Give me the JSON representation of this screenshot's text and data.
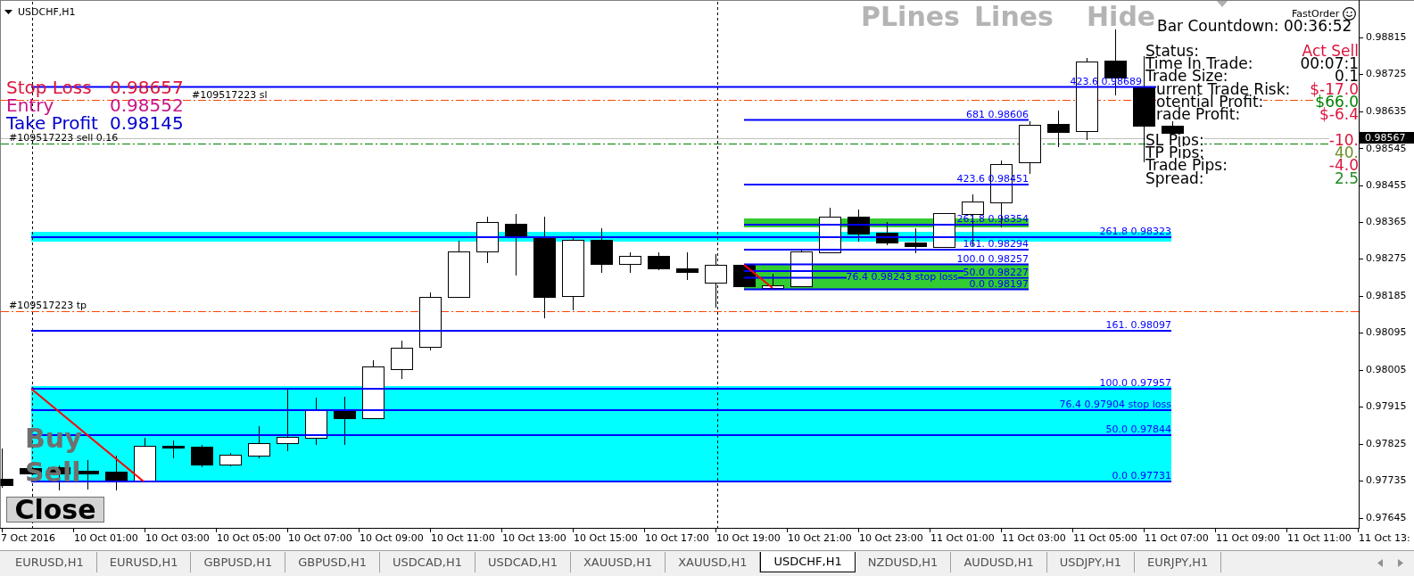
{
  "window": {
    "title": "USDCHF,H1"
  },
  "overlay_buttons": [
    "PLines",
    "Lines",
    "Hide"
  ],
  "trade_summary": [
    {
      "label": "Stop Loss",
      "value": "0.98657",
      "color": "#dc143c"
    },
    {
      "label": "Entry",
      "value": "0.98552",
      "color": "#c71585"
    },
    {
      "label": "Take Profit",
      "value": "0.98145",
      "color": "#0000cd"
    }
  ],
  "order_lines": [
    {
      "kind": "sl",
      "label": "#109517223 sl"
    },
    {
      "kind": "open",
      "label": "#109517223 sell 0.16"
    },
    {
      "kind": "tp",
      "label": "#109517223 tp"
    }
  ],
  "fibonacci": [
    {
      "levels": [
        "423.6 0.98689",
        "261.8 0.98323",
        "161. 0.98097",
        "100.0 0.97957",
        "76.4 0.97904 stop loss",
        "50.0 0.97844",
        "0.0 0.97731"
      ]
    },
    {
      "levels": [
        "681 0.98606",
        "423.6 0.98451",
        "261.8 0.98354",
        "161. 0.98294",
        "100.0 0.98257",
        "76.4 0.98243 stop loss",
        "50.0 0.98227",
        "0.0 0.98197"
      ]
    }
  ],
  "info_panel": {
    "brand": "FastOrder",
    "countdown": "Bar Countdown: 00:36:52",
    "sections": [
      {
        "rows": [
          {
            "label": "Status:",
            "value": "Act Sell",
            "color": "#dc143c"
          },
          {
            "label": "Time In Trade:",
            "value": "00:07:1",
            "color": "#000000"
          },
          {
            "label": "Trade Size:",
            "value": "0.1",
            "color": "#000000"
          },
          {
            "label": "urrent Trade Risk:",
            "value": "$-17.0",
            "color": "#dc143c"
          },
          {
            "label": "otential Profit:",
            "value": "$66.0",
            "color": "#008000"
          },
          {
            "label": "rade Profit:",
            "value": "$-6.4",
            "color": "#dc143c"
          }
        ]
      },
      {
        "rows": [
          {
            "label": "SL Pips:",
            "value": "-10.",
            "color": "#dc143c"
          },
          {
            "label": "TP Pips:",
            "value": "40.",
            "color": "#6b8e23"
          },
          {
            "label": "Trade Pips:",
            "value": "-4.0",
            "color": "#dc143c"
          },
          {
            "label": "Spread:",
            "value": "2.5",
            "color": "#228b22"
          }
        ]
      }
    ]
  },
  "order_buttons": [
    "Buy",
    "Sell"
  ],
  "close_button": "Close",
  "price_axis": {
    "ticks": [
      "0.98815",
      "0.98725",
      "0.98635",
      "0.98545",
      "0.98455",
      "0.98365",
      "0.98275",
      "0.98185",
      "0.98095",
      "0.98005",
      "0.97915",
      "0.97825",
      "0.97735",
      "0.97645"
    ],
    "current": "0.98567"
  },
  "time_axis": [
    "7 Oct 2016",
    "10 Oct 01:00",
    "10 Oct 03:00",
    "10 Oct 05:00",
    "10 Oct 07:00",
    "10 Oct 09:00",
    "10 Oct 11:00",
    "10 Oct 13:00",
    "10 Oct 15:00",
    "10 Oct 17:00",
    "10 Oct 19:00",
    "10 Oct 21:00",
    "10 Oct 23:00",
    "11 Oct 01:00",
    "11 Oct 03:00",
    "11 Oct 05:00",
    "11 Oct 07:00",
    "11 Oct 09:00",
    "11 Oct 11:00",
    "11 Oct 13:"
  ],
  "tabs": [
    {
      "label": "EURUSD,H1",
      "selected": false
    },
    {
      "label": "EURUSD,H1",
      "selected": false
    },
    {
      "label": "GBPUSD,H1",
      "selected": false
    },
    {
      "label": "GBPUSD,H1",
      "selected": false
    },
    {
      "label": "USDCAD,H1",
      "selected": false
    },
    {
      "label": "USDCAD,H1",
      "selected": false
    },
    {
      "label": "XAUUSD,H1",
      "selected": false
    },
    {
      "label": "XAUUSD,H1",
      "selected": false
    },
    {
      "label": "USDCHF,H1",
      "selected": true
    },
    {
      "label": "NZDUSD,H1",
      "selected": false
    },
    {
      "label": "AUDUSD,H1",
      "selected": false
    },
    {
      "label": "USDJPY,H1",
      "selected": false
    },
    {
      "label": "EURJPY,H1",
      "selected": false
    }
  ]
}
